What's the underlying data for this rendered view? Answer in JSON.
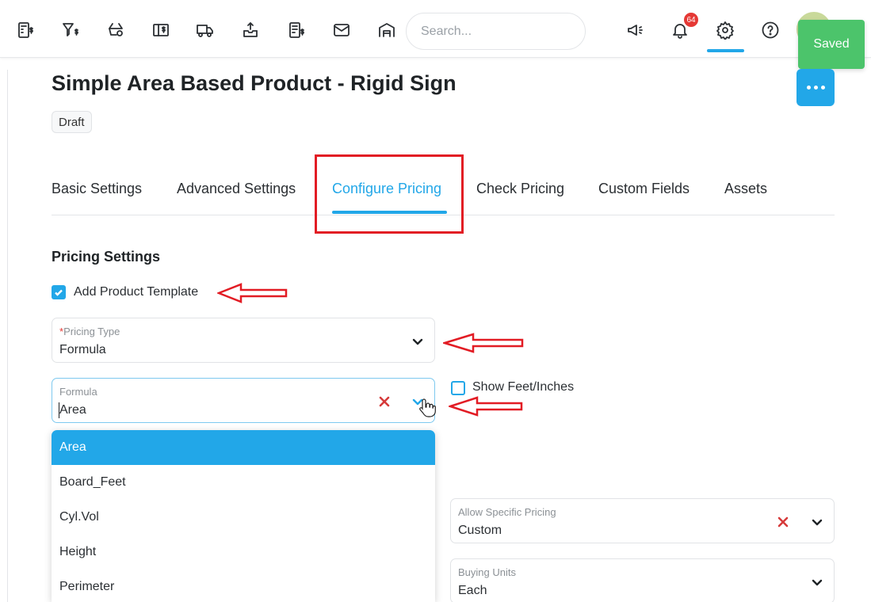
{
  "toast": {
    "text": "Saved"
  },
  "search": {
    "placeholder": "Search..."
  },
  "notifications": {
    "count": "64"
  },
  "toolbar": {
    "icons": [
      "invoice-icon",
      "price-filter-icon",
      "product-basket-icon",
      "catalog-icon",
      "shipping-truck-icon",
      "inbox-icon",
      "report-icon",
      "mail-icon",
      "warehouse-icon",
      "megaphone-icon",
      "bell-icon",
      "gear-icon",
      "help-icon"
    ]
  },
  "page": {
    "title": "Simple Area Based Product - Rigid Sign",
    "status": "Draft"
  },
  "tabs": [
    {
      "label": "Basic Settings"
    },
    {
      "label": "Advanced Settings"
    },
    {
      "label": "Configure Pricing",
      "active": true
    },
    {
      "label": "Check Pricing"
    },
    {
      "label": "Custom Fields"
    },
    {
      "label": "Assets"
    }
  ],
  "pricing": {
    "section_title": "Pricing Settings",
    "add_template_label": "Add Product Template",
    "add_template_checked": true,
    "pricing_type": {
      "required_mark": "*",
      "label": "Pricing Type",
      "value": "Formula"
    },
    "formula": {
      "label": "Formula",
      "value": "Area"
    },
    "show_feet_label": "Show Feet/Inches",
    "show_feet_checked": false,
    "allow_specific": {
      "label": "Allow Specific Pricing",
      "value": "Custom"
    },
    "buying_units": {
      "label": "Buying Units",
      "value": "Each"
    }
  },
  "formula_options": [
    "Area",
    "Board_Feet",
    "Cyl.Vol",
    "Height",
    "Perimeter"
  ],
  "colors": {
    "accent": "#22a7e8",
    "annotation_red": "#e21c24",
    "toast_green": "#4cc46b",
    "badge_red": "#e53935"
  }
}
